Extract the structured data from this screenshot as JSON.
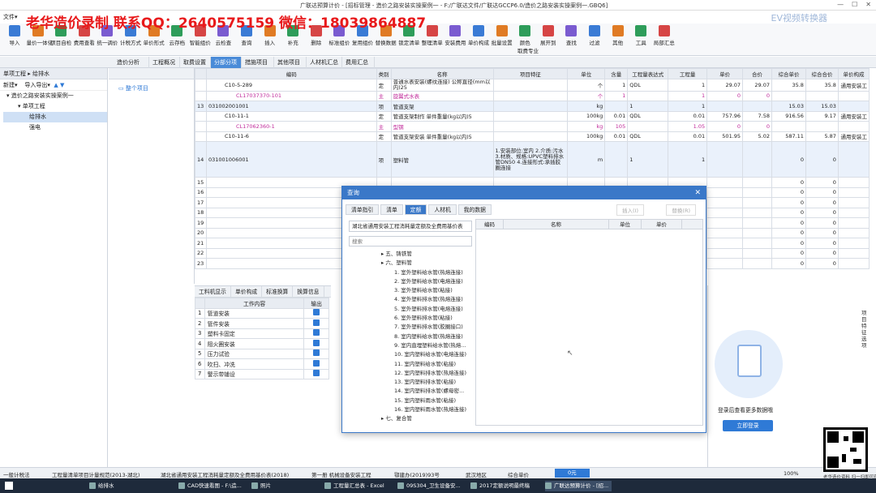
{
  "window": {
    "title": "广联达预算计价 - [招标管理 - 造价之路安装实操案例一 - F:/广联达文件/广联达GCCP6.0/造价之路安装实操案例一.GBQ6]"
  },
  "watermark": "老华造价录制 联系QQ：2640575159 微信：18039864887",
  "ev_label": "EV视频转换器",
  "menu": {
    "file": "文件▾"
  },
  "ribbon": [
    "导入",
    "量价一体化",
    "项目自检",
    "费用查看",
    "统一调价",
    "计税方式",
    "单价形式",
    "云存档",
    "智能组价",
    "云检查",
    "查询",
    "插入",
    "补充",
    "删除",
    "标准组价",
    "复用组价",
    "替换数据",
    "锁定清单",
    "整理清单",
    "安装费用",
    "单价构成",
    "批量设置",
    "颜色",
    "展开到",
    "查找",
    "过滤",
    "其他",
    "工具",
    "局部汇总"
  ],
  "ribbon_sub": "取费专业",
  "breadcrumb": "单项工程 ▸ 给排水",
  "tabs": [
    "造价分析",
    "工程概况",
    "取费设置",
    "分部分项",
    "措施项目",
    "其他项目",
    "人材机汇总",
    "费用汇总"
  ],
  "active_tab": "分部分项",
  "left_toolbar": {
    "new": "新建▾",
    "import_export": "导入导出▾"
  },
  "tree": [
    {
      "label": "造价之路安装实操案例一",
      "level": 0
    },
    {
      "label": "单项工程",
      "level": 1
    },
    {
      "label": "给排水",
      "level": 2,
      "selected": true
    },
    {
      "label": "强电",
      "level": 2
    }
  ],
  "mid_panel": {
    "item": "整个项目"
  },
  "grid": {
    "columns": [
      "",
      "编码",
      "类别",
      "名称",
      "项目特征",
      "单位",
      "含量",
      "工程量表达式",
      "工程量",
      "单价",
      "合价",
      "综合单价",
      "综合合价",
      "单价构成"
    ],
    "rows": [
      [
        "",
        "C10-5-289",
        "定",
        "普通水表安装(螺纹连接) 公称直径(mm以内)25",
        "",
        "个",
        "1",
        "QDL",
        "1",
        "29.07",
        "29.07",
        "35.8",
        "35.8",
        "通用安装工"
      ],
      [
        "",
        "CL17037370-101",
        "主",
        "旋翼式水表",
        "",
        "个",
        "1",
        "",
        "1",
        "0",
        "0",
        "",
        "",
        ""
      ],
      [
        "13",
        "031002001001",
        "项",
        "管道支架",
        "",
        "kg",
        "",
        "1",
        "1",
        "",
        "",
        "15.03",
        "15.03",
        ""
      ],
      [
        "",
        "C10-11-1",
        "定",
        "管道支架制作 单件重量(kg以内)5",
        "",
        "100kg",
        "0.01",
        "QDL",
        "0.01",
        "757.96",
        "7.58",
        "916.56",
        "9.17",
        "通用安装工"
      ],
      [
        "",
        "CL17062360-1",
        "主",
        "型钢",
        "",
        "kg",
        "105",
        "",
        "1.05",
        "0",
        "0",
        "",
        "",
        ""
      ],
      [
        "",
        "C10-11-6",
        "定",
        "管道支架安装 单件重量(kg以内)5",
        "",
        "100kg",
        "0.01",
        "QDL",
        "0.01",
        "501.95",
        "5.02",
        "587.11",
        "5.87",
        "通用安装工"
      ],
      [
        "14",
        "031001006001",
        "项",
        "塑料管",
        "1.安装部位:室内 2.介质:污水 3.材质、规格:UPVC塑料排水管DN50 4.连接形式:承插胶圈连接",
        "m",
        "",
        "1",
        "1",
        "",
        "",
        "0",
        "0",
        ""
      ],
      [
        "15",
        "",
        "",
        "",
        "",
        "",
        "",
        "",
        "",
        "",
        "",
        "0",
        "0",
        ""
      ],
      [
        "16",
        "",
        "",
        "",
        "",
        "",
        "",
        "",
        "",
        "",
        "",
        "0",
        "0",
        ""
      ],
      [
        "17",
        "",
        "",
        "",
        "",
        "",
        "",
        "",
        "",
        "",
        "",
        "0",
        "0",
        ""
      ],
      [
        "18",
        "",
        "",
        "",
        "",
        "",
        "",
        "",
        "",
        "",
        "",
        "0",
        "0",
        ""
      ],
      [
        "19",
        "",
        "",
        "",
        "",
        "",
        "",
        "",
        "",
        "",
        "",
        "0",
        "0",
        ""
      ],
      [
        "20",
        "",
        "",
        "",
        "",
        "",
        "",
        "",
        "",
        "",
        "",
        "0",
        "0",
        ""
      ],
      [
        "21",
        "",
        "",
        "",
        "",
        "",
        "",
        "",
        "",
        "",
        "",
        "0",
        "0",
        ""
      ],
      [
        "22",
        "",
        "",
        "",
        "",
        "",
        "",
        "",
        "",
        "",
        "",
        "0",
        "0",
        ""
      ],
      [
        "23",
        "",
        "",
        "",
        "",
        "",
        "",
        "",
        "",
        "",
        "",
        "0",
        "0",
        ""
      ]
    ]
  },
  "bottom_tabs": [
    "工料机显示",
    "单价构成",
    "标准换算",
    "换算信息"
  ],
  "work": {
    "headers": [
      "工作内容",
      "输出"
    ],
    "rows": [
      "管道安装",
      "管件安装",
      "塑料卡固定",
      "阻火圈安装",
      "压力试验",
      "吹扫、冲洗",
      "警示带铺设"
    ]
  },
  "dialog": {
    "title": "查询",
    "tabs": [
      "清单指引",
      "清单",
      "定额",
      "人材机",
      "我的数据"
    ],
    "active_tab": "定额",
    "insert": "插入(I)",
    "replace": "替换(R)",
    "library": "湖北省通用安装工程消耗量定额及全费用基价表",
    "search_placeholder": "搜索",
    "tree": [
      "五、铸铁管",
      "六、塑料管",
      "1. 室外塑料给水管(热熔连接)",
      "2. 室外塑料给水管(电熔连接)",
      "3. 室外塑料给水管(粘接)",
      "4. 室外塑料排水管(热熔连接)",
      "5. 室外塑料排水管(电熔连接)",
      "6. 室外塑料排水管(粘接)",
      "7. 室外塑料排水管(胶圈接口)",
      "8. 室内塑料给水管(热熔连接)",
      "9. 室内直埋塑料给水管(热熔...",
      "10. 室内塑料给水管(电熔连接)",
      "11. 室内塑料给水管(粘接)",
      "12. 室内塑料排水管(热熔连接)",
      "13. 室内塑料排水管(粘接)",
      "14. 室内塑料排水管(螺母密...",
      "15. 室内塑料雨水管(粘接)",
      "16. 室内塑料雨水管(热熔连接)",
      "七、复合管"
    ],
    "grid_headers": [
      "编码",
      "名称",
      "单位",
      "单价"
    ]
  },
  "login_panel": {
    "side_label": "项目特征选项",
    "text": "登录后查看更多数据哦",
    "button": "立即登录"
  },
  "status": [
    "一般计税法",
    "工程量清单项目计量规范(2013-湖北)",
    "湖北省通用安装工程消耗量定额及全费用基价表(2018)",
    "第一册 机械设备安装工程",
    "鄂建办(2019)93号",
    "武汉地区",
    "综合单价",
    "0元",
    "100%"
  ],
  "taskbar": [
    "给排水",
    "CAD快速看图 - F:\\造...",
    "照片",
    "工程量汇总表 - Excel",
    "09S304_卫生设备安...",
    "2017定额说明最终稿",
    "广联达预算计价 - [招..."
  ],
  "qr_caption": "老华造价资料 扫一扫即可获取",
  "colors": {
    "accent": "#3a78c8",
    "watermark": "#e8191b"
  }
}
